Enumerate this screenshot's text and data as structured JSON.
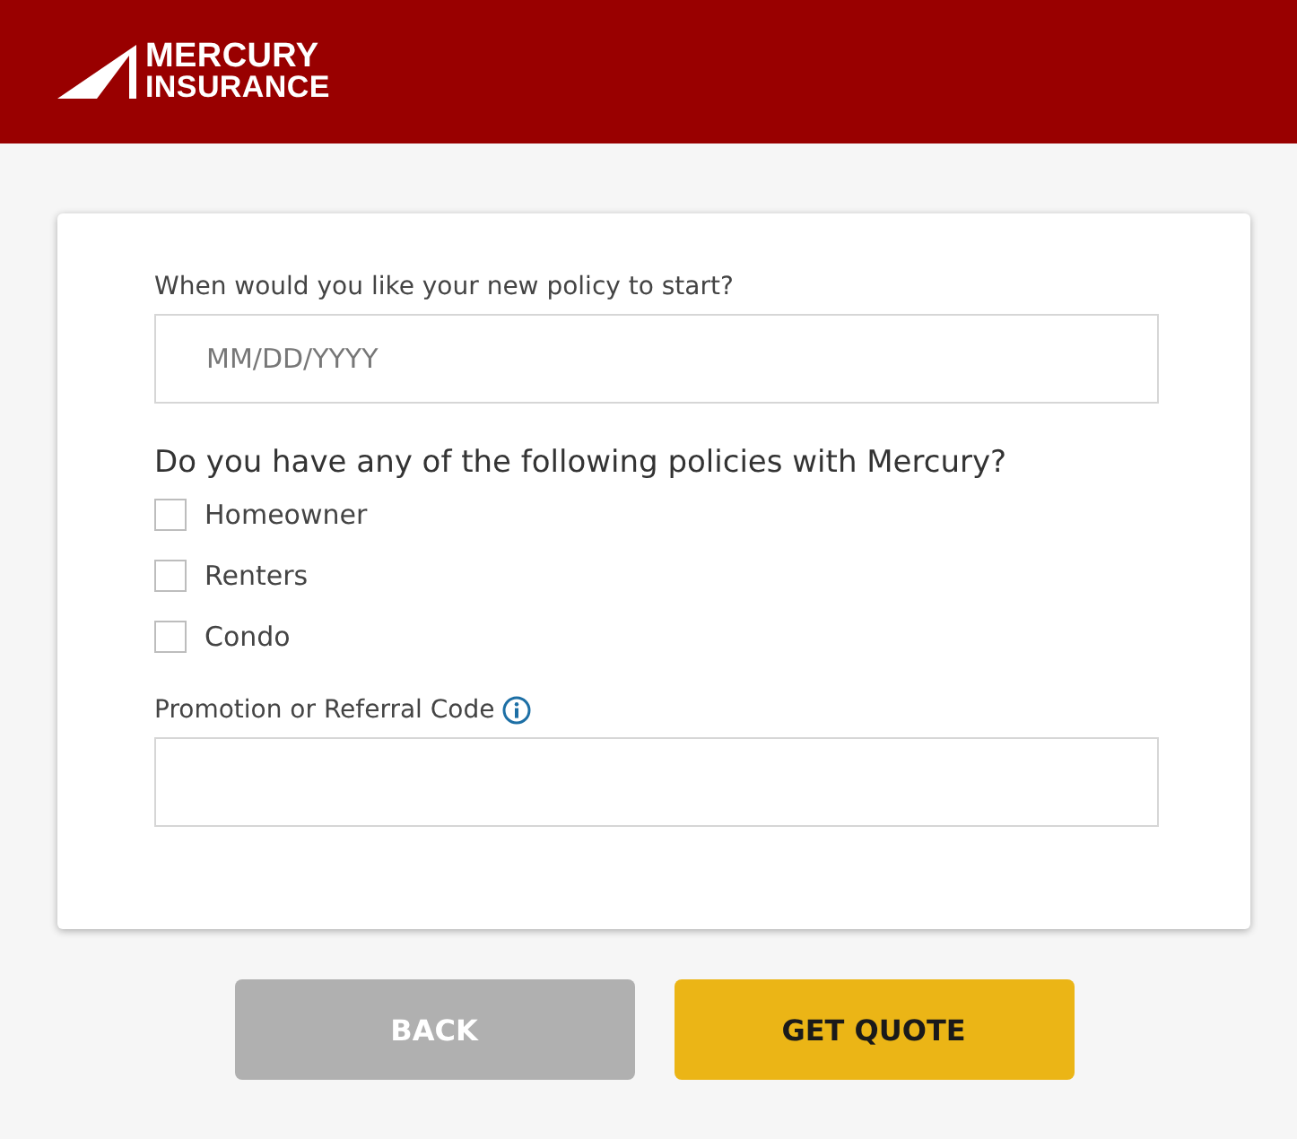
{
  "header": {
    "logo": {
      "line_1": "MERCURY",
      "line_2": "INSURANCE"
    }
  },
  "form": {
    "start_date": {
      "label": "When would you like your new policy to start?",
      "placeholder": "MM/DD/YYYY"
    },
    "policies": {
      "question": "Do you have any of the following policies with Mercury?",
      "options": [
        {
          "label": "Homeowner",
          "checked": false
        },
        {
          "label": "Renters",
          "checked": false
        },
        {
          "label": "Condo",
          "checked": false
        }
      ]
    },
    "promo_code": {
      "label": "Promotion or Referral Code",
      "info": true
    }
  },
  "buttons": [
    {
      "label": "BACK",
      "kind": "secondary"
    },
    {
      "label": "GET QUOTE",
      "kind": "primary"
    }
  ]
}
